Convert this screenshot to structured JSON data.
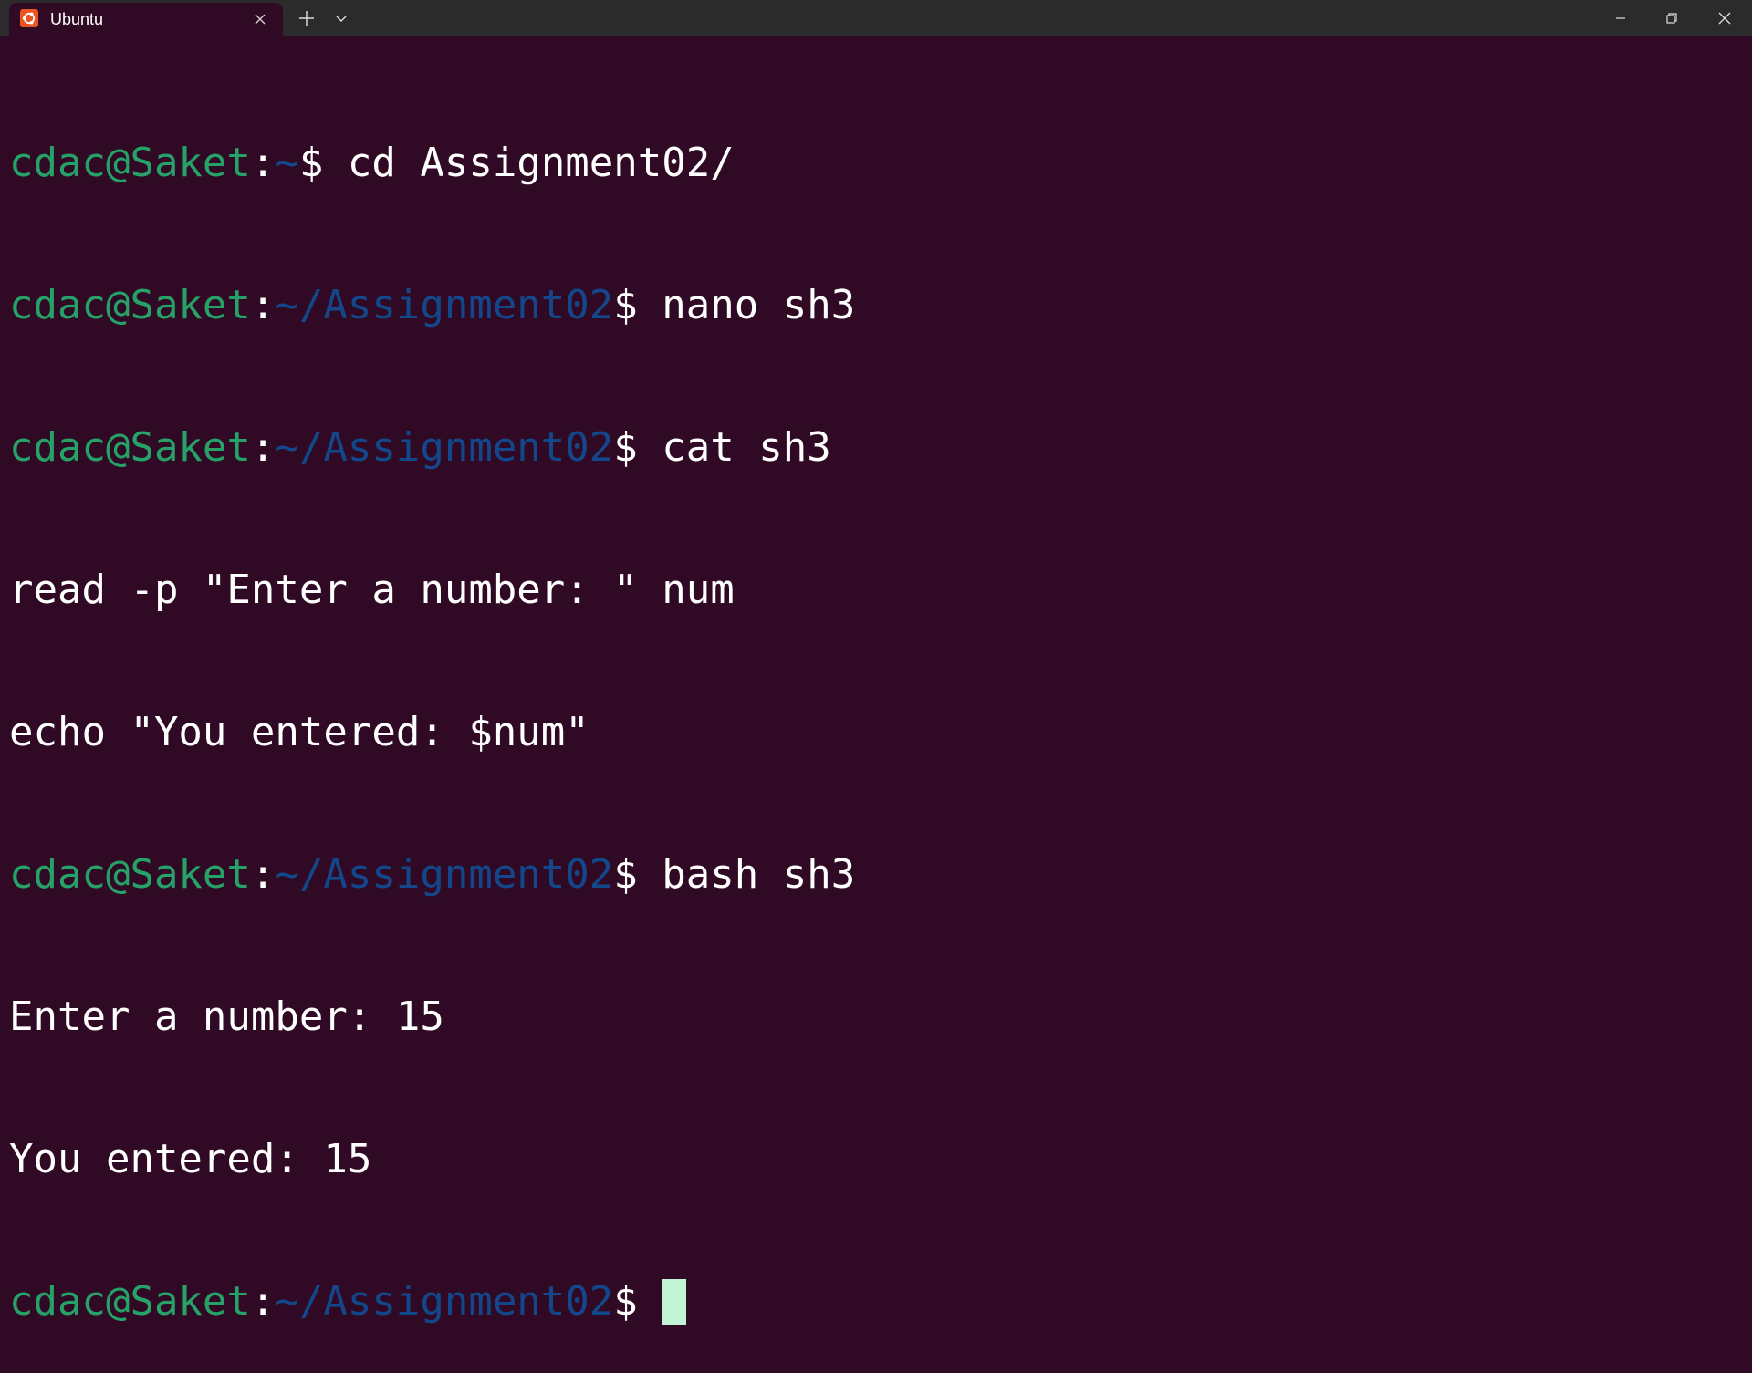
{
  "window": {
    "tab_title": "Ubuntu",
    "tab_icon": "ubuntu-logo-icon",
    "accent_color": "#e95420",
    "background_color": "#300a24"
  },
  "prompt": {
    "user_host": "cdac@Saket",
    "colon": ":",
    "dollar": "$ ",
    "user_color": "#26a269",
    "path_color": "#12488b"
  },
  "terminal": {
    "line1": {
      "path": "~",
      "command": "cd Assignment02/"
    },
    "line2": {
      "path": "~/Assignment02",
      "command": "nano sh3"
    },
    "line3": {
      "path": "~/Assignment02",
      "command": "cat sh3"
    },
    "output1": "read -p \"Enter a number: \" num",
    "output2": "echo \"You entered: $num\"",
    "line6": {
      "path": "~/Assignment02",
      "command": "bash sh3"
    },
    "output3": "Enter a number: 15",
    "output4": "You entered: 15",
    "line9": {
      "path": "~/Assignment02",
      "command": ""
    }
  }
}
